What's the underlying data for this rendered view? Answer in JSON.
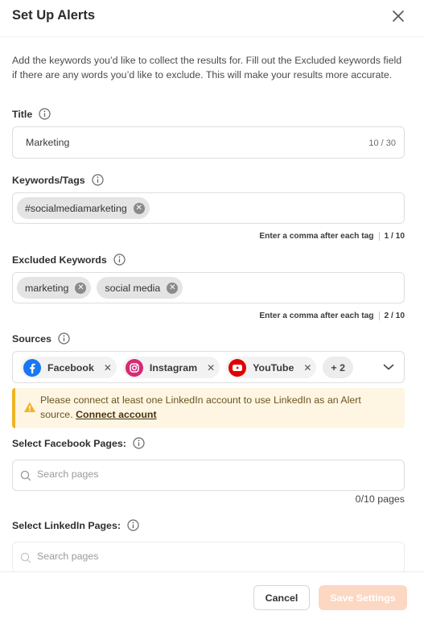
{
  "dialog": {
    "title": "Set Up Alerts"
  },
  "intro": "Add the keywords you’d like to collect the results for. Fill out the Excluded keywords field if there are any words you’d like to exclude. This will make your results more accurate.",
  "title_field": {
    "label": "Title",
    "value": "Marketing",
    "counter": "10 / 30"
  },
  "keywords": {
    "label": "Keywords/Tags",
    "tags": [
      "#socialmediamarketing"
    ],
    "hint": "Enter a comma after each tag",
    "count": "1 / 10"
  },
  "excluded": {
    "label": "Excluded Keywords",
    "tags": [
      "marketing",
      "social media"
    ],
    "hint": "Enter a comma after each tag",
    "count": "2 / 10"
  },
  "sources": {
    "label": "Sources",
    "items": [
      {
        "name": "Facebook",
        "icon": "facebook-icon",
        "color": "#1877f2"
      },
      {
        "name": "Instagram",
        "icon": "instagram-icon",
        "color": "#d62976"
      },
      {
        "name": "YouTube",
        "icon": "youtube-icon",
        "color": "#e00000"
      }
    ],
    "more": "+ 2"
  },
  "warning": {
    "text": "Please connect at least one LinkedIn account to use LinkedIn as an Alert source.",
    "link": "Connect account"
  },
  "facebook_pages": {
    "label": "Select Facebook Pages:",
    "placeholder": "Search pages",
    "count": "0/10 pages"
  },
  "linkedin_pages": {
    "label": "Select LinkedIn Pages:",
    "placeholder": "Search pages"
  },
  "footer": {
    "cancel": "Cancel",
    "save": "Save Settings"
  },
  "colors": {
    "accent": "#fcd7c2",
    "warning_bg": "#fef6e3",
    "warning_border": "#f0b323"
  }
}
